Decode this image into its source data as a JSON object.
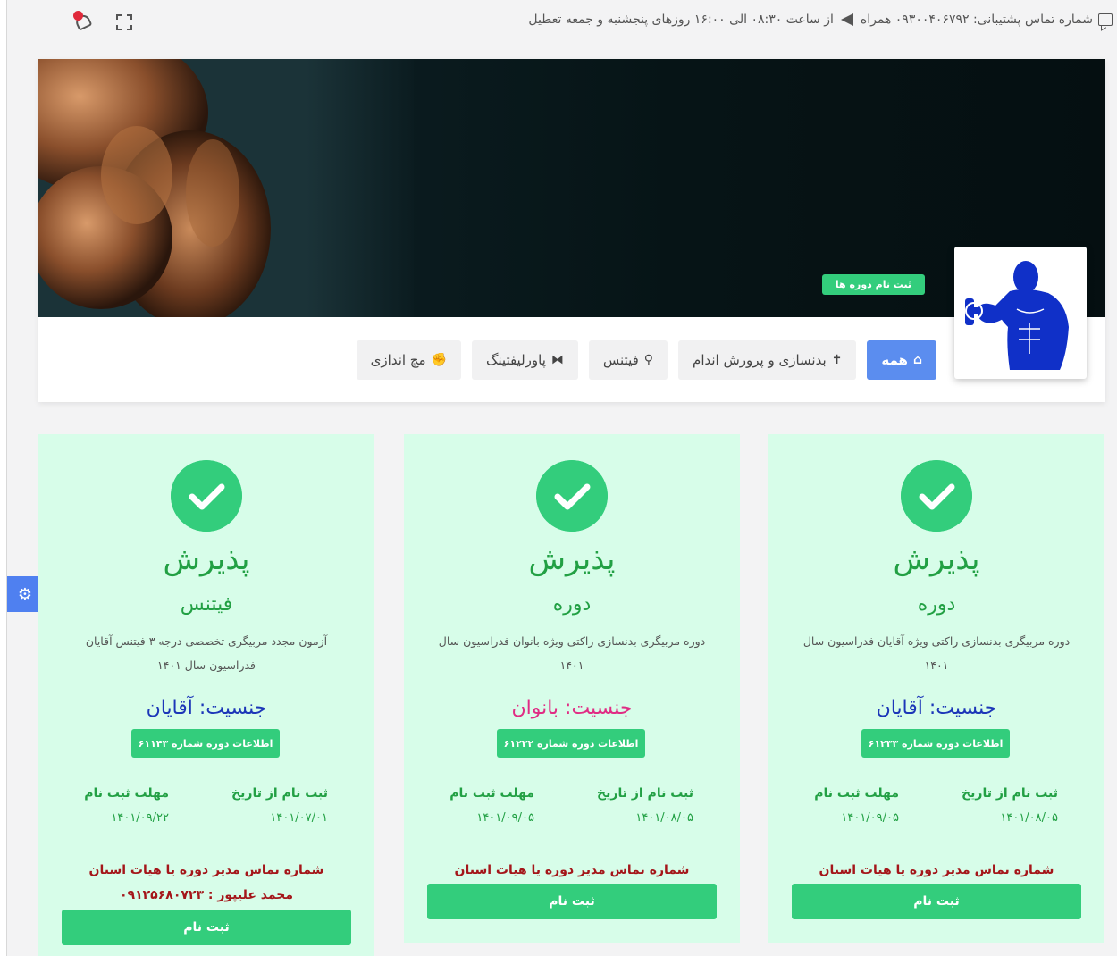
{
  "topbar": {
    "support_text": "شماره تماس پشتیبانی: ۰۹۳۰۰۴۰۶۷۹۲ همراه",
    "hours_text": "از ساعت ۰۸:۳۰ الی ۱۶:۰۰ روزهای پنجشنبه و جمعه تعطیل"
  },
  "banner": {
    "register_courses_label": "ثبت نام دوره ها"
  },
  "tabs": [
    {
      "label": "همه",
      "icon": "home-icon",
      "active": true
    },
    {
      "label": "بدنسازی و پرورش اندام",
      "icon": "person-icon"
    },
    {
      "label": "فیتنس",
      "icon": "running-icon"
    },
    {
      "label": "پاورلیفتینگ",
      "icon": "dumbbell-icon"
    },
    {
      "label": "مچ اندازی",
      "icon": "thumbs-up-icon"
    }
  ],
  "cards": [
    {
      "status": "پذیرش",
      "category": "دوره",
      "description": "دوره مربیگری بدنسازی راکتی ویژه آقایان فدراسیون سال ۱۴۰۱",
      "gender": "جنسیت: آقایان",
      "info_label": "اطلاعات دوره شماره ۶۱۲۳۳",
      "reg_from_label": "ثبت نام از تاریخ",
      "reg_from": "۱۴۰۱/۰۸/۰۵",
      "deadline_label": "مهلت ثبت نام",
      "deadline": "۱۴۰۱/۰۹/۰۵",
      "contact_label": "شماره تماس مدیر دوره یا هیات استان",
      "contact_person": "",
      "register_label": "ثبت نام"
    },
    {
      "status": "پذیرش",
      "category": "دوره",
      "description": "دوره مربیگری بدنسازی راکتی ویژه بانوان فدراسیون سال ۱۴۰۱",
      "gender": "جنسیت: بانوان",
      "info_label": "اطلاعات دوره شماره ۶۱۲۳۲",
      "reg_from_label": "ثبت نام از تاریخ",
      "reg_from": "۱۴۰۱/۰۸/۰۵",
      "deadline_label": "مهلت ثبت نام",
      "deadline": "۱۴۰۱/۰۹/۰۵",
      "contact_label": "شماره تماس مدیر دوره یا هیات استان",
      "contact_person": "",
      "register_label": "ثبت نام"
    },
    {
      "status": "پذیرش",
      "category": "فیتنس",
      "description": "آزمون مجدد مربیگری تخصصی درجه ۳ فیتنس آقایان فدراسیون سال ۱۴۰۱",
      "gender": "جنسیت: آقایان",
      "info_label": "اطلاعات دوره شماره ۶۱۱۴۳",
      "reg_from_label": "ثبت نام از تاریخ",
      "reg_from": "۱۴۰۱/۰۷/۰۱",
      "deadline_label": "مهلت ثبت نام",
      "deadline": "۱۴۰۱/۰۹/۲۲",
      "contact_label": "شماره تماس مدیر دوره یا هیات استان",
      "contact_person": "محمد علیپور : ۰۹۱۲۵۶۸۰۷۲۳",
      "register_label": "ثبت نام"
    }
  ],
  "colors": {
    "accent_green": "#33cd7c",
    "card_bg": "#d7fde9",
    "active_tab_blue": "#5b8def",
    "male_blue": "#1c36b8",
    "female_pink": "#e02c84",
    "contact_red": "#a4161a"
  }
}
